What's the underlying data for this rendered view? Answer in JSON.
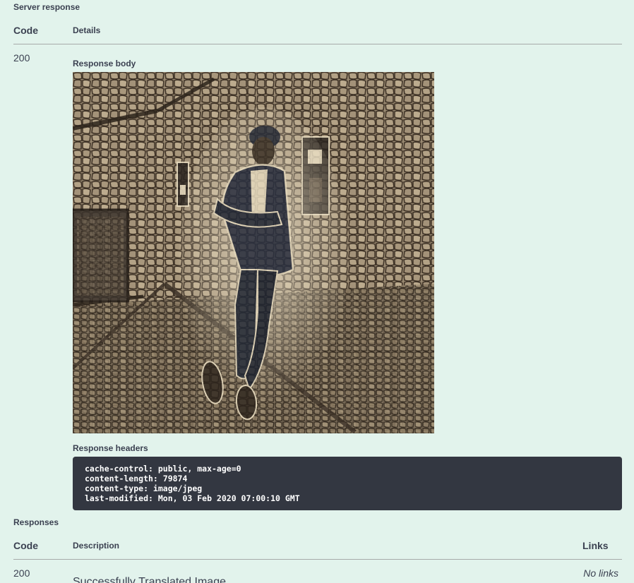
{
  "server_response": {
    "title": "Server response",
    "col_code": "Code",
    "col_details": "Details",
    "status_code": "200",
    "body_title": "Response body",
    "image": {
      "description": "stylized photo of a person in a dark outfit and beanie leaning against a tiled wall",
      "style": "stained-glass / cracked mosaic filter",
      "palette": [
        "#8c7d68",
        "#2a3040",
        "#e8dcc0",
        "#4a3e30"
      ]
    },
    "headers_title": "Response headers",
    "headers": [
      "cache-control: public, max-age=0",
      "content-length: 79874",
      "content-type: image/jpeg",
      "last-modified: Mon, 03 Feb 2020 07:00:10 GMT"
    ]
  },
  "responses": {
    "title": "Responses",
    "col_code": "Code",
    "col_description": "Description",
    "col_links": "Links",
    "rows": [
      {
        "code": "200",
        "description": "Successfully Translated Image",
        "links": "No links"
      }
    ]
  }
}
